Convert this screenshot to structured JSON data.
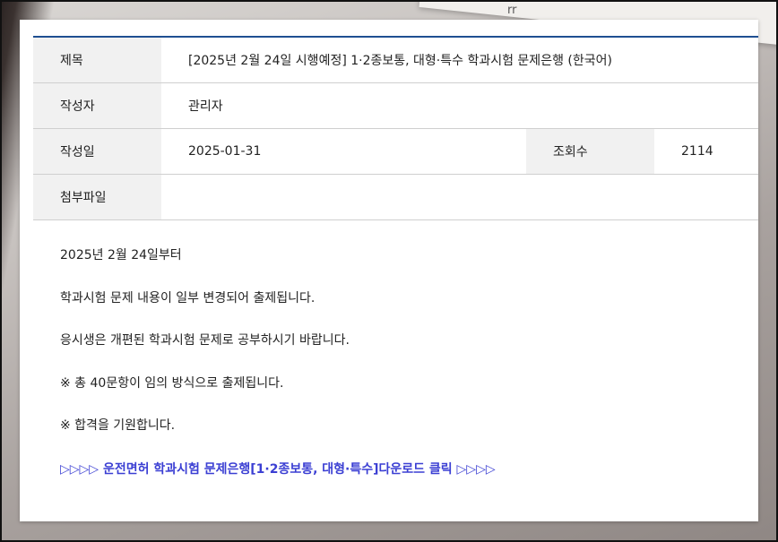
{
  "post": {
    "labels": {
      "title": "제목",
      "author": "작성자",
      "date": "작성일",
      "views": "조회수",
      "attachment": "첨부파일"
    },
    "title": "[2025년 2월 24일 시행예정] 1·2종보통, 대형·특수 학과시험 문제은행 (한국어)",
    "author": "관리자",
    "date": "2025-01-31",
    "views": "2114",
    "attachment": ""
  },
  "body": {
    "paragraphs": [
      "2025년 2월 24일부터",
      "학과시험 문제 내용이 일부 변경되어 출제됩니다.",
      "응시생은 개편된 학과시험 문제로 공부하시기 바랍니다.",
      "※ 총 40문항이 임의 방식으로 출제됩니다.",
      "※ 합격을 기원합니다."
    ],
    "download_link": "▷▷▷▷ 운전면허 학과시험 문제은행[1·2종보통, 대형·특수]다운로드 클릭 ▷▷▷▷"
  },
  "background": {
    "paper_mark": "rr"
  },
  "colors": {
    "accent_border": "#1f4f91",
    "header_cell_bg": "#f1f1f1",
    "link": "#3b3fd3"
  }
}
